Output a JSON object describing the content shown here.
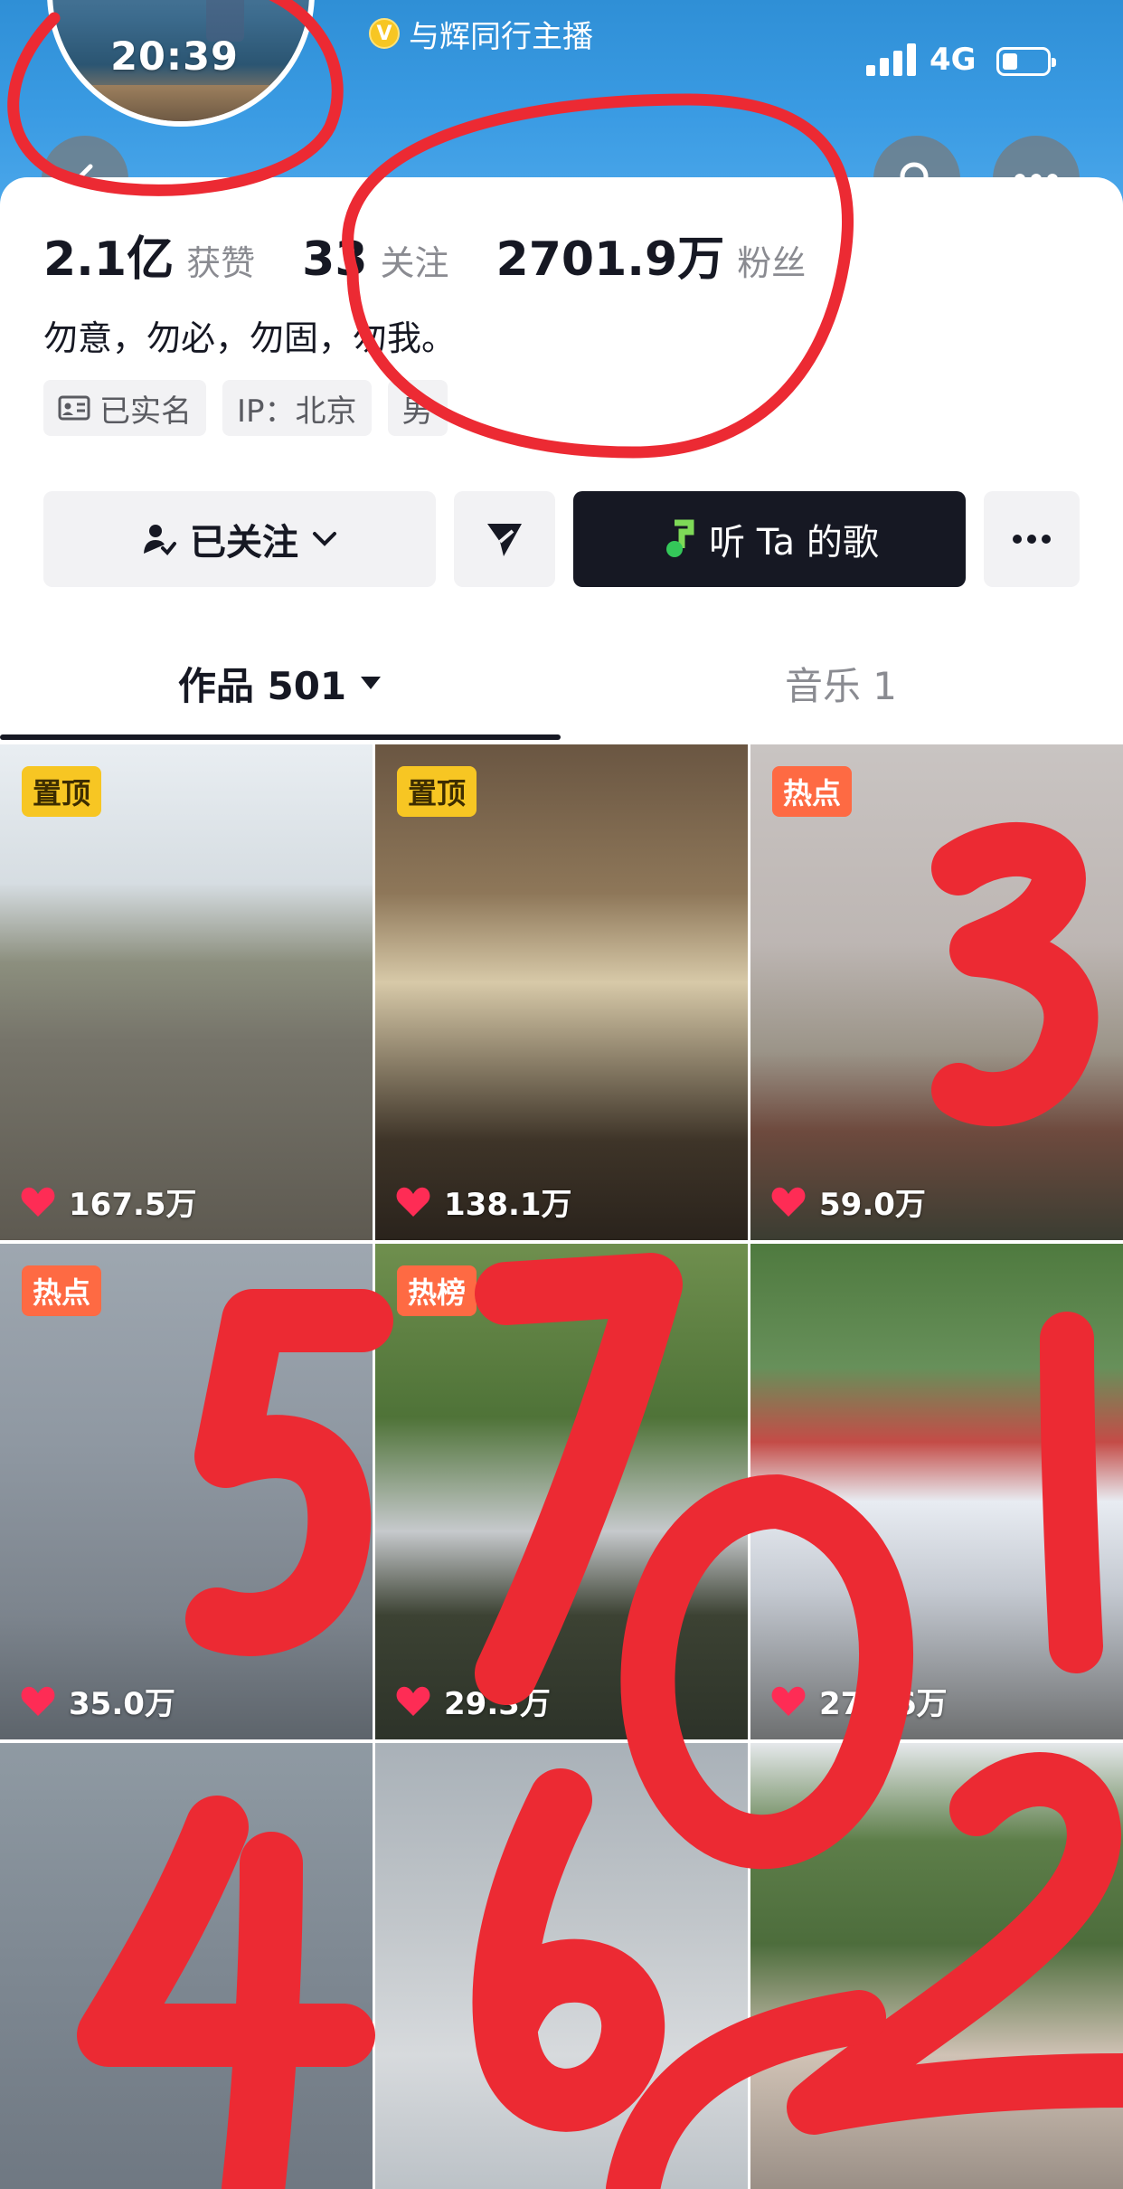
{
  "status_bar": {
    "time": "20:39",
    "network": "4G",
    "signal_bars": 4,
    "battery_level": 0.3
  },
  "header": {
    "verified_badge": "V",
    "title": "与辉同行主播"
  },
  "profile": {
    "stats": [
      {
        "value": "2.1亿",
        "label": "获赞"
      },
      {
        "value": "33",
        "label": "关注"
      },
      {
        "value": "2701.9万",
        "label": "粉丝"
      }
    ],
    "bio": "勿意，勿必，勿固，勿我。",
    "tags": [
      {
        "icon": "id-card-icon",
        "label": "已实名"
      },
      {
        "label": "IP：北京"
      },
      {
        "label": "男"
      }
    ]
  },
  "actions": {
    "follow_label": "已关注",
    "song_label": "听 Ta 的歌"
  },
  "tabs": {
    "works_label": "作品 501",
    "music_label": "音乐 1"
  },
  "videos": [
    {
      "badge": "置顶",
      "badge_type": "pin",
      "likes": "167.5万"
    },
    {
      "badge": "置顶",
      "badge_type": "pin",
      "likes": "138.1万"
    },
    {
      "badge": "热点",
      "badge_type": "hot",
      "likes": "59.0万"
    },
    {
      "badge": "热点",
      "badge_type": "hot",
      "likes": "35.0万"
    },
    {
      "badge": "热榜",
      "badge_type": "hot",
      "likes": "29.3万"
    },
    {
      "badge": "",
      "badge_type": "",
      "likes": "278.6万"
    },
    {
      "badge": "",
      "badge_type": "",
      "likes": ""
    },
    {
      "badge": "",
      "badge_type": "",
      "likes": ""
    },
    {
      "badge": "",
      "badge_type": "",
      "likes": ""
    }
  ],
  "colors": {
    "accent_dark": "#161823",
    "pin_badge": "#f7c623",
    "hot_badge": "#fe6a43",
    "like_heart": "#fe2c55",
    "annotation_red": "#ec2a33",
    "header_blue": "#3a9be3"
  },
  "annotations": {
    "numbers": [
      "3",
      "5",
      "7",
      "0",
      "1",
      "4",
      "6",
      "2"
    ]
  }
}
